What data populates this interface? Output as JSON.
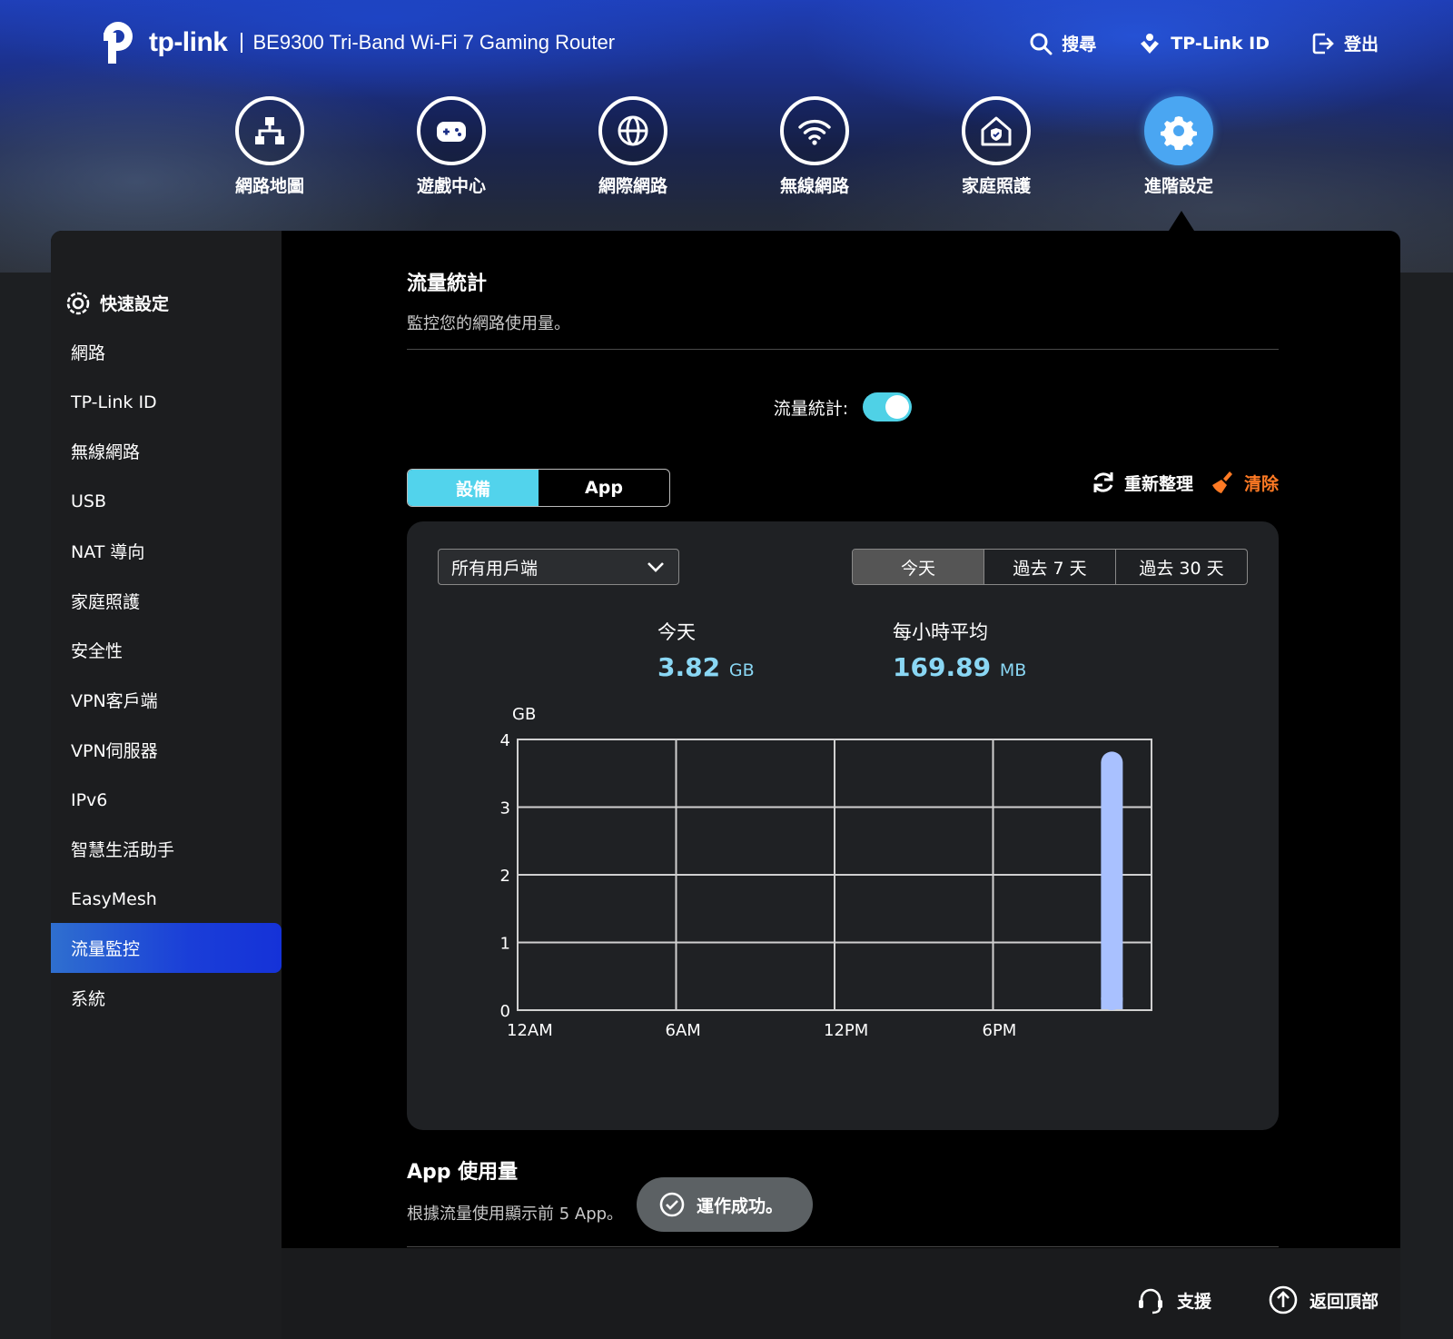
{
  "header": {
    "logo_text": "tp-link",
    "product_name": "BE9300 Tri-Band Wi-Fi 7 Gaming Router",
    "actions": {
      "search": "搜尋",
      "tplink_id": "TP-Link ID",
      "logout": "登出"
    }
  },
  "main_nav": [
    {
      "label": "網路地圖",
      "icon": "network-map-icon"
    },
    {
      "label": "遊戲中心",
      "icon": "gamepad-icon"
    },
    {
      "label": "網際網路",
      "icon": "globe-icon"
    },
    {
      "label": "無線網路",
      "icon": "wifi-icon"
    },
    {
      "label": "家庭照護",
      "icon": "home-shield-icon"
    },
    {
      "label": "進階設定",
      "icon": "gear-icon",
      "active": true
    }
  ],
  "sidebar": {
    "items": [
      {
        "label": "快速設定"
      },
      {
        "label": "網路"
      },
      {
        "label": "TP-Link ID"
      },
      {
        "label": "無線網路"
      },
      {
        "label": "USB"
      },
      {
        "label": "NAT 導向"
      },
      {
        "label": "家庭照護"
      },
      {
        "label": "安全性"
      },
      {
        "label": "VPN客戶端"
      },
      {
        "label": "VPN伺服器"
      },
      {
        "label": "IPv6"
      },
      {
        "label": "智慧生活助手"
      },
      {
        "label": "EasyMesh"
      },
      {
        "label": "流量監控",
        "active": true
      },
      {
        "label": "系統"
      }
    ]
  },
  "traffic": {
    "title": "流量統計",
    "desc": "監控您的網路使用量。",
    "toggle_label": "流量統計:",
    "toggle_on": true,
    "tabs": [
      "設備",
      "App"
    ],
    "active_tab": 0,
    "refresh_label": "重新整理",
    "clear_label": "清除",
    "client_select": "所有用戶端",
    "periods": [
      "今天",
      "過去 7 天",
      "過去 30 天"
    ],
    "active_period": 0,
    "stats": {
      "today_label": "今天",
      "today_value": "3.82",
      "today_unit": "GB",
      "avg_label": "每小時平均",
      "avg_value": "169.89",
      "avg_unit": "MB"
    }
  },
  "chart_data": {
    "type": "bar",
    "ylabel": "GB",
    "ylim": [
      0,
      4
    ],
    "yticks": [
      "0",
      "1",
      "2",
      "3",
      "4"
    ],
    "xticks": [
      "12AM",
      "6AM",
      "12PM",
      "6PM"
    ],
    "x_range_hours": [
      0,
      24
    ],
    "bars": [
      {
        "hour": 22.5,
        "value": 3.82
      }
    ],
    "grid": true,
    "bar_color": "#a9c1ff"
  },
  "app_usage": {
    "title": "App 使用量",
    "desc": "根據流量使用顯示前 5 App。"
  },
  "toast": {
    "text": "運作成功。"
  },
  "footer": {
    "support": "支援",
    "back_to_top": "返回頂部"
  },
  "colors": {
    "accent": "#52d3ec",
    "active_nav": "#4aa6f2",
    "clear": "#ff7a24",
    "stat_value": "#8ad7f4"
  }
}
